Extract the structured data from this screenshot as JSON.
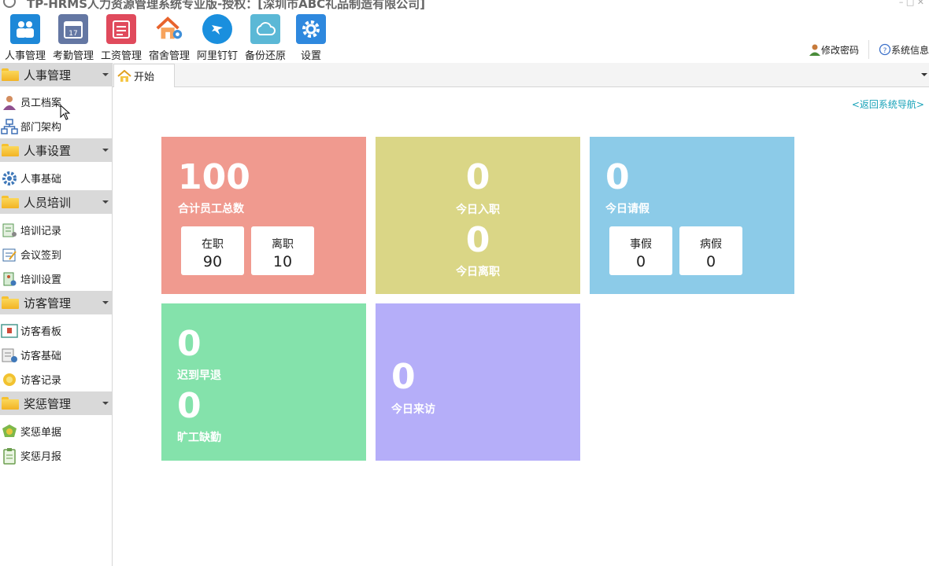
{
  "app": {
    "title": "TP-HRMS人力资源管理系统专业版-授权：[深圳市ABC礼品制造有限公司]"
  },
  "toolbar": {
    "items": [
      {
        "label": "人事管理",
        "icon": "personnel-icon",
        "color": "#1e88d8"
      },
      {
        "label": "考勤管理",
        "icon": "calendar-icon",
        "color": "#6477a3"
      },
      {
        "label": "工资管理",
        "icon": "payroll-icon",
        "color": "#e04a5c"
      },
      {
        "label": "宿舍管理",
        "icon": "house-icon",
        "color": "#ef7a3b"
      },
      {
        "label": "阿里钉钉",
        "icon": "dingtalk-icon",
        "color": "#1a8fde"
      },
      {
        "label": "备份还原",
        "icon": "cloud-icon",
        "color": "#5bb8d6"
      },
      {
        "label": "设置",
        "icon": "gear-icon",
        "color": "#2e88de"
      }
    ],
    "change_password": "修改密码",
    "system_info": "系统信息"
  },
  "sidebar": {
    "groups": [
      {
        "label": "人事管理",
        "items": [
          {
            "label": "员工档案",
            "icon": "employee-icon"
          },
          {
            "label": "部门架构",
            "icon": "org-chart-icon"
          }
        ]
      },
      {
        "label": "人事设置",
        "items": [
          {
            "label": "人事基础",
            "icon": "gear-icon"
          }
        ]
      },
      {
        "label": "人员培训",
        "items": [
          {
            "label": "培训记录",
            "icon": "training-record-icon"
          },
          {
            "label": "会议签到",
            "icon": "sign-in-icon"
          },
          {
            "label": "培训设置",
            "icon": "training-settings-icon"
          }
        ]
      },
      {
        "label": "访客管理",
        "items": [
          {
            "label": "访客看板",
            "icon": "board-icon"
          },
          {
            "label": "访客基础",
            "icon": "visitor-base-icon"
          },
          {
            "label": "访客记录",
            "icon": "visitor-record-icon"
          }
        ]
      },
      {
        "label": "奖惩管理",
        "items": [
          {
            "label": "奖惩单据",
            "icon": "reward-icon"
          },
          {
            "label": "奖惩月报",
            "icon": "report-icon"
          }
        ]
      }
    ]
  },
  "tabs": [
    {
      "label": "开始",
      "icon": "home-icon"
    }
  ],
  "back_link": "<返回系统导航>",
  "cards": {
    "total": {
      "value": "100",
      "label": "合计员工总数",
      "active_label": "在职",
      "active_value": "90",
      "left_label": "离职",
      "left_value": "10",
      "color": "#f09a8f"
    },
    "today": {
      "entry_value": "0",
      "entry_label": "今日入职",
      "leave_value": "0",
      "leave_label": "今日离职",
      "color": "#dad686"
    },
    "leave": {
      "value": "0",
      "label": "今日请假",
      "personal_label": "事假",
      "personal_value": "0",
      "sick_label": "病假",
      "sick_value": "0",
      "color": "#8ccbe8"
    },
    "attendance": {
      "late_value": "0",
      "late_label": "迟到早退",
      "absent_value": "0",
      "absent_label": "旷工缺勤",
      "color": "#84e2ab"
    },
    "visit": {
      "value": "0",
      "label": "今日来访",
      "color": "#b5aef9"
    }
  }
}
